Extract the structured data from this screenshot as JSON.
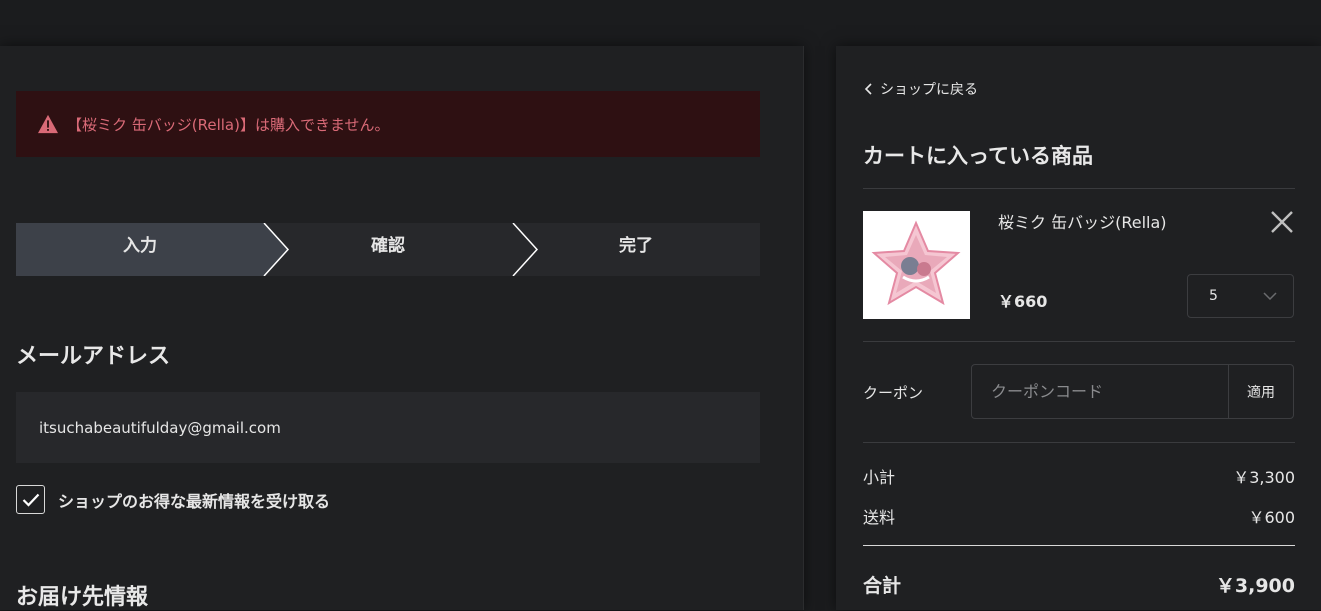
{
  "error": {
    "message": "【桜ミク 缶バッジ(Rella)】は購入できません。"
  },
  "steps": [
    "入力",
    "確認",
    "完了"
  ],
  "email_section": {
    "title": "メールアドレス",
    "value": "itsuchabeautifulday@gmail.com"
  },
  "newsletter": {
    "label": "ショップのお得な最新情報を受け取る",
    "checked": true
  },
  "shipping_section": {
    "title": "お届け先情報"
  },
  "cart": {
    "back_label": "ショップに戻る",
    "title": "カートに入っている商品",
    "item": {
      "name": "桜ミク 缶バッジ(Rella)",
      "price": "￥660",
      "quantity": "5"
    },
    "coupon": {
      "label": "クーポン",
      "placeholder": "クーポンコード",
      "apply_label": "適用"
    },
    "summary": {
      "subtotal_label": "小計",
      "subtotal_value": "￥3,300",
      "shipping_label": "送料",
      "shipping_value": "￥600",
      "total_label": "合計",
      "total_value": "￥3,900"
    }
  },
  "colors": {
    "error_bg": "#2e1012",
    "error_text": "#d96a77",
    "active_step": "#3d4149"
  }
}
